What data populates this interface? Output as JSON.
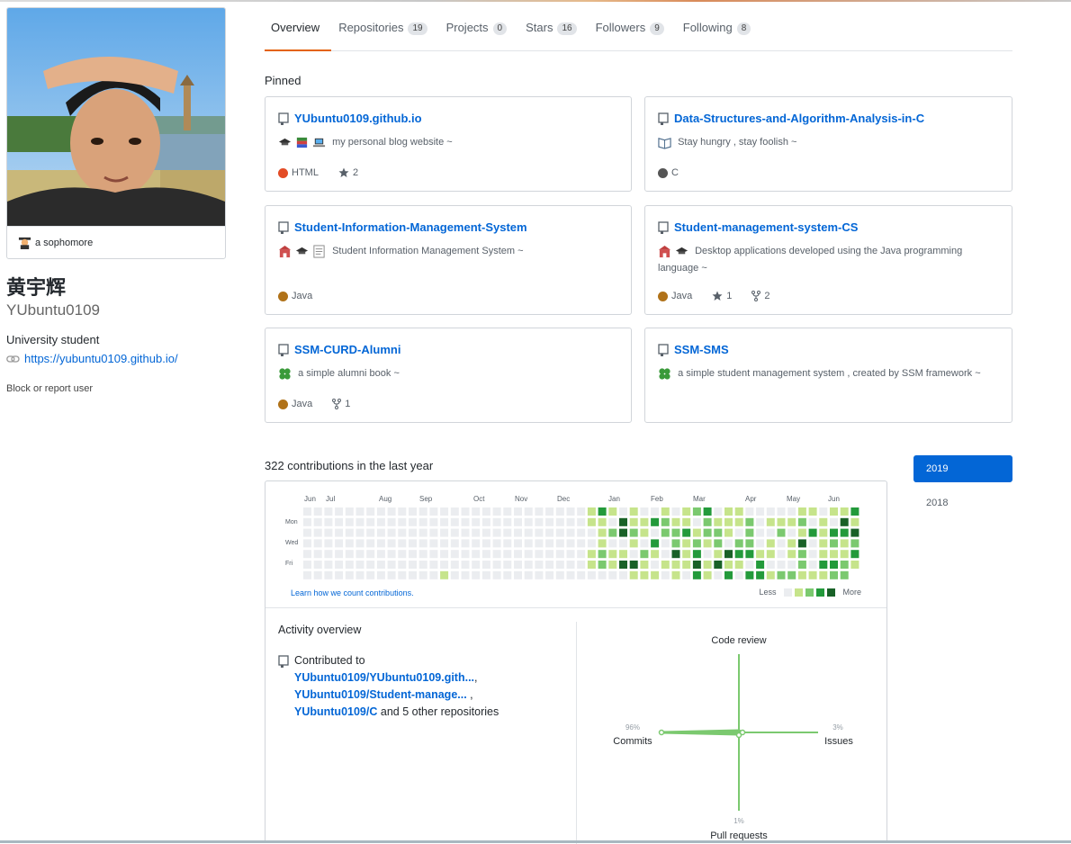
{
  "profile": {
    "status_text": "a sophomore",
    "fullname": "黄宇辉",
    "username": "YUbuntu0109",
    "bio": "University student",
    "website": "https://yubuntu0109.github.io/",
    "block_link": "Block or report user"
  },
  "tabs": [
    {
      "label": "Overview",
      "count": ""
    },
    {
      "label": "Repositories",
      "count": "19"
    },
    {
      "label": "Projects",
      "count": "0"
    },
    {
      "label": "Stars",
      "count": "16"
    },
    {
      "label": "Followers",
      "count": "9"
    },
    {
      "label": "Following",
      "count": "8"
    }
  ],
  "pinned": {
    "label": "Pinned",
    "repos": [
      {
        "name": "YUbuntu0109.github.io",
        "desc": "my personal blog website ~",
        "lang": "HTML",
        "lang_color": "#e34c26",
        "stars": "2",
        "forks": ""
      },
      {
        "name": "Data-Structures-and-Algorithm-Analysis-in-C",
        "desc": "Stay hungry , stay foolish ~",
        "lang": "C",
        "lang_color": "#555555",
        "stars": "",
        "forks": ""
      },
      {
        "name": "Student-Information-Management-System",
        "desc": "Student Information Management System ~",
        "lang": "Java",
        "lang_color": "#b07219",
        "stars": "",
        "forks": ""
      },
      {
        "name": "Student-management-system-CS",
        "desc": "Desktop applications developed using the Java programming language ~",
        "lang": "Java",
        "lang_color": "#b07219",
        "stars": "1",
        "forks": "2"
      },
      {
        "name": "SSM-CURD-Alumni",
        "desc": "a simple alumni book ~",
        "lang": "Java",
        "lang_color": "#b07219",
        "stars": "",
        "forks": "1"
      },
      {
        "name": "SSM-SMS",
        "desc": "a simple student management system , created by SSM framework ~",
        "lang": "",
        "lang_color": "",
        "stars": "",
        "forks": ""
      }
    ]
  },
  "contributions": {
    "heading": "322 contributions in the last year",
    "months": [
      "Jun",
      "Jul",
      "Aug",
      "Sep",
      "Oct",
      "Nov",
      "Dec",
      "Jan",
      "Feb",
      "Mar",
      "Apr",
      "May",
      "Jun"
    ],
    "days": [
      "Mon",
      "Wed",
      "Fri"
    ],
    "learn_link": "Learn how we count contributions.",
    "legend_less": "Less",
    "legend_more": "More",
    "level_colors": [
      "#ebedf0",
      "#c6e48b",
      "#7bc96f",
      "#239a3b",
      "#196127"
    ]
  },
  "activity": {
    "title": "Activity overview",
    "contributed_to": "Contributed to",
    "repos": [
      "YUbuntu0109/YUbuntu0109.gith...",
      "YUbuntu0109/Student-manage...",
      "YUbuntu0109/C"
    ],
    "others": "and 5 other repositories",
    "radar": {
      "code_review_label": "Code review",
      "commits_label": "Commits",
      "commits_pct": "96%",
      "issues_label": "Issues",
      "issues_pct": "3%",
      "pr_label": "Pull requests",
      "pr_pct": "1%"
    }
  },
  "years": [
    "2019",
    "2018"
  ],
  "colors": {
    "link": "#0366d6",
    "accent": "#e36209",
    "radar": "#7bc96f"
  }
}
